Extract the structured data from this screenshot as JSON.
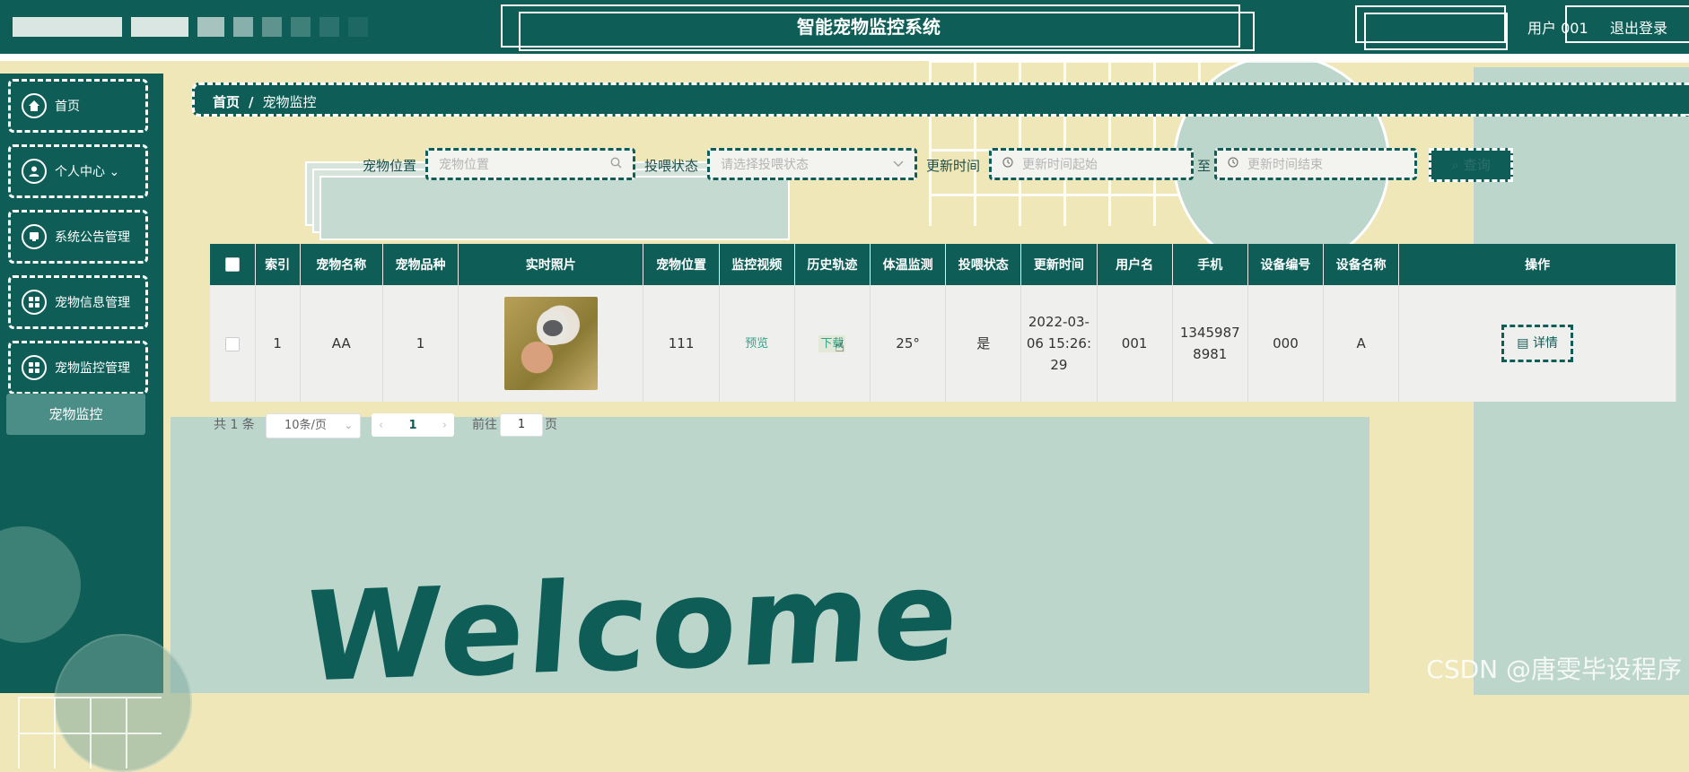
{
  "header": {
    "title": "智能宠物监控系统",
    "user": "用户 001",
    "logout": "退出登录"
  },
  "sidebar": {
    "items": [
      {
        "label": "首页",
        "icon": "home-icon"
      },
      {
        "label": "个人中心 ⌄",
        "icon": "user-icon"
      },
      {
        "label": "系统公告管理",
        "icon": "notice-icon"
      },
      {
        "label": "宠物信息管理",
        "icon": "grid-icon"
      },
      {
        "label": "宠物监控管理",
        "icon": "grid-icon"
      }
    ],
    "submenu": "宠物监控"
  },
  "breadcrumb": {
    "home": "首页",
    "sep": "/",
    "current": "宠物监控"
  },
  "search": {
    "location_label": "宠物位置",
    "location_placeholder": "宠物位置",
    "feed_label": "投喂状态",
    "feed_placeholder": "请选择投喂状态",
    "time_label": "更新时间",
    "time_start_placeholder": "更新时间起始",
    "time_to": "至",
    "time_end_placeholder": "更新时间结束",
    "query_button": "查询"
  },
  "table": {
    "columns": [
      "索引",
      "宠物名称",
      "宠物品种",
      "实时照片",
      "宠物位置",
      "监控视频",
      "历史轨迹",
      "体温监测",
      "投喂状态",
      "更新时间",
      "用户名",
      "手机",
      "设备编号",
      "设备名称",
      "操作"
    ],
    "rows": [
      {
        "index": "1",
        "name": "AA",
        "breed": "1",
        "location": "111",
        "video": "预览",
        "track": "下载",
        "temperature": "25°",
        "feed": "是",
        "update_time": "2022-03-06 15:26:29",
        "username": "001",
        "phone": "13459878981",
        "device_no": "000",
        "device_name": "A",
        "action": "详情"
      }
    ]
  },
  "pagination": {
    "total": "共 1 条",
    "page_size": "10条/页",
    "current_page": "1",
    "goto": "前往",
    "goto_value": "1",
    "page_suffix": "页"
  },
  "decor": {
    "welcome": "Welcome",
    "watermark": "CSDN @唐雯毕设程序"
  },
  "colors": {
    "primary": "#0e5e57",
    "background": "#efe7b8",
    "mint": "#bdd6cc",
    "link": "#32a48a"
  }
}
